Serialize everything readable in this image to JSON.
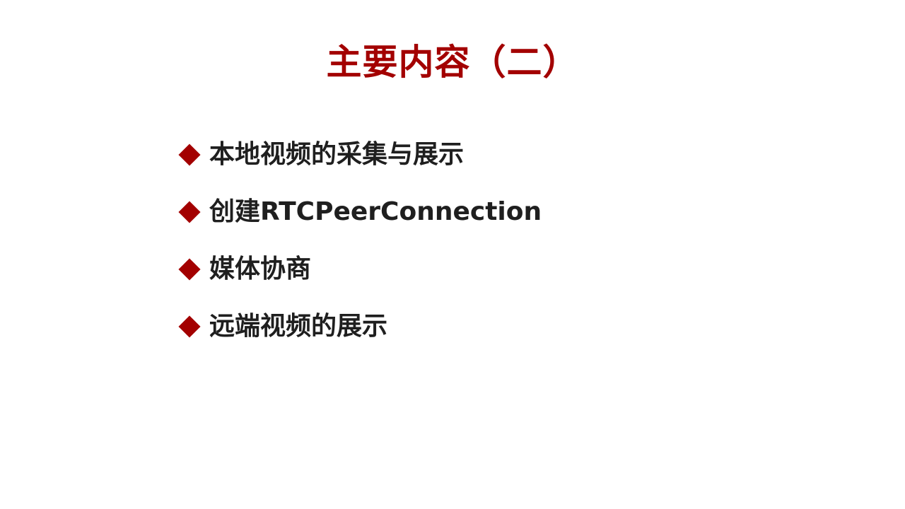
{
  "slide": {
    "title": "主要内容（二）",
    "title_color": "#A30000",
    "bullet_icon": "diamond-icon",
    "bullet_color": "#A30000",
    "text_color": "#1F1F1F",
    "bullets": [
      {
        "label": "本地视频的采集与展示"
      },
      {
        "label": "创建RTCPeerConnection"
      },
      {
        "label": "媒体协商"
      },
      {
        "label": "远端视频的展示"
      }
    ]
  }
}
